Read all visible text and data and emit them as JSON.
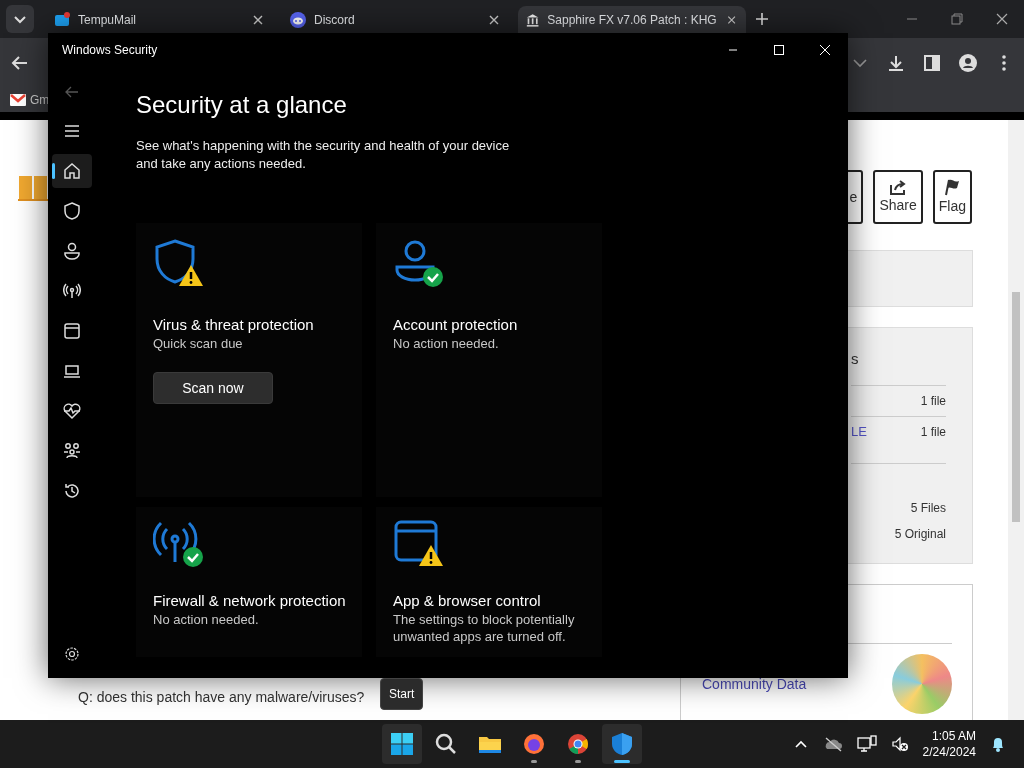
{
  "browser": {
    "tabs": [
      {
        "title": "TempuMail",
        "kind": "mail",
        "selected": false
      },
      {
        "title": "Discord",
        "kind": "discord",
        "selected": false
      },
      {
        "title": "Sapphire FX v7.06 Patch : KHG",
        "kind": "museum",
        "selected": true
      }
    ],
    "bookmarks": [
      {
        "label": "Gm",
        "kind": "gmail"
      }
    ],
    "page": {
      "action_buttons": [
        {
          "label": "e",
          "kind": "plain"
        },
        {
          "label": "Share",
          "kind": "share"
        },
        {
          "label": "Flag",
          "kind": "flag"
        }
      ],
      "files_heading": "s",
      "file_rows": [
        {
          "count": "1 file"
        },
        {
          "name": "LE",
          "count": "1 file"
        }
      ],
      "totals": [
        "5 Files",
        "5 Original"
      ],
      "community_link": "Community Data",
      "question": "Q: does this patch have any malware/viruses?"
    }
  },
  "security_window": {
    "title": "Windows Security",
    "back_disabled": true,
    "nav": [
      {
        "kind": "home",
        "selected": true
      },
      {
        "kind": "shield",
        "selected": false
      },
      {
        "kind": "person",
        "selected": false
      },
      {
        "kind": "antenna",
        "selected": false
      },
      {
        "kind": "window",
        "selected": false
      },
      {
        "kind": "laptop",
        "selected": false
      },
      {
        "kind": "heart",
        "selected": false
      },
      {
        "kind": "family",
        "selected": false
      },
      {
        "kind": "history",
        "selected": false
      }
    ],
    "heading": "Security at a glance",
    "description": "See what's happening with the security and health of your device and take any actions needed.",
    "cards": [
      {
        "kind": "shield",
        "alert": true,
        "title": "Virus & threat protection",
        "status": "Quick scan due",
        "button": "Scan now"
      },
      {
        "kind": "person",
        "alert": false,
        "title": "Account protection",
        "status": "No action needed."
      },
      {
        "kind": "antenna",
        "alert": false,
        "title": "Firewall & network protection",
        "status": "No action needed."
      },
      {
        "kind": "window",
        "alert": true,
        "title": "App & browser control",
        "status": "The settings to block potentially unwanted apps are turned off."
      }
    ]
  },
  "tooltip": "Start",
  "taskbar": {
    "start_hovered": true,
    "apps": [
      {
        "kind": "search",
        "running": false,
        "focused": false
      },
      {
        "kind": "folder",
        "running": false,
        "focused": false
      },
      {
        "kind": "firefox",
        "running": true,
        "focused": false
      },
      {
        "kind": "chrome",
        "running": true,
        "focused": false
      },
      {
        "kind": "defender",
        "running": true,
        "focused": true
      }
    ],
    "clock": {
      "time": "1:05 AM",
      "date": "2/24/2024"
    }
  }
}
